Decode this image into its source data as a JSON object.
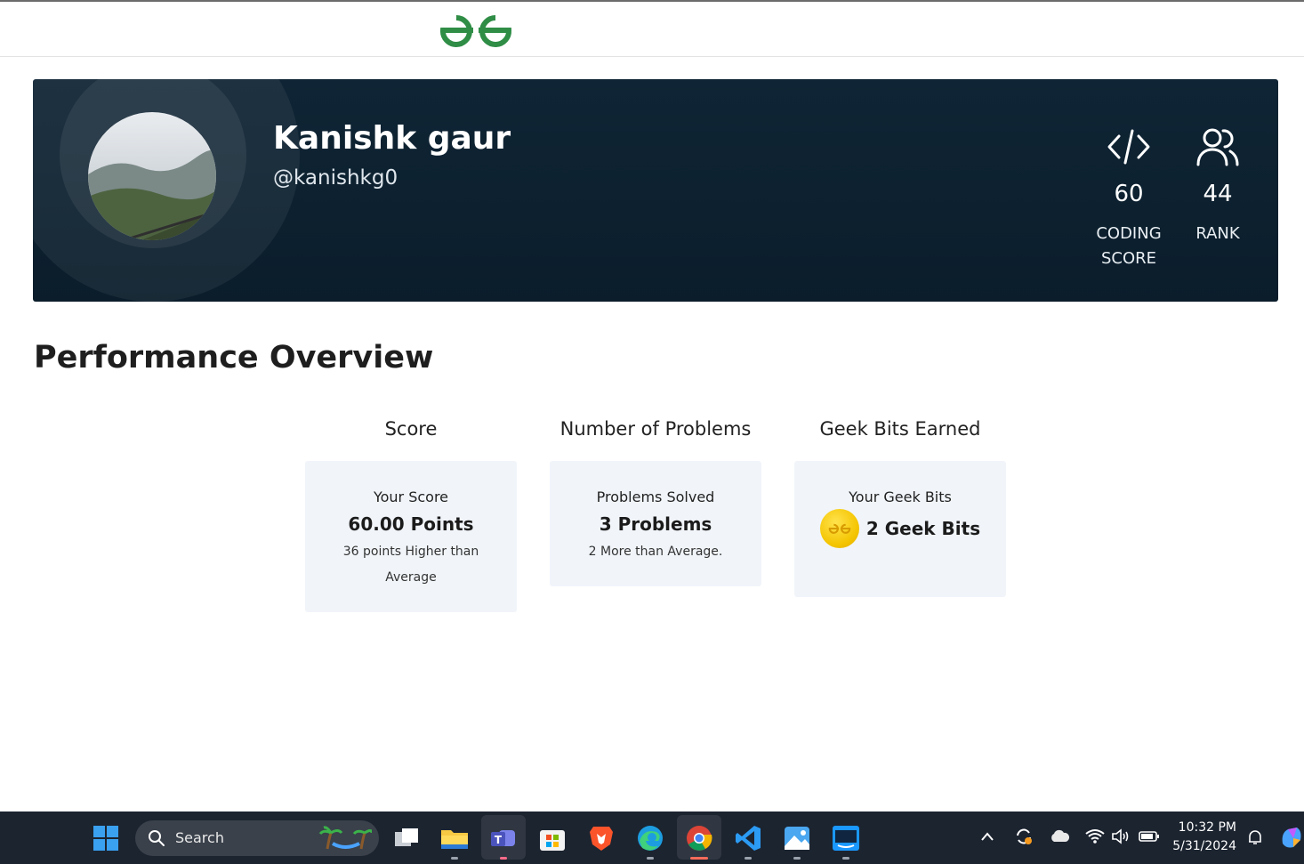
{
  "profile": {
    "name": "Kanishk gaur",
    "handle": "@kanishkg0",
    "stats": [
      {
        "value": "60",
        "label_line1": "CODING",
        "label_line2": "SCORE"
      },
      {
        "value": "44",
        "label_line1": "RANK",
        "label_line2": ""
      }
    ]
  },
  "performance": {
    "title": "Performance Overview",
    "columns": [
      {
        "heading": "Score",
        "label": "Your Score",
        "value": "60.00 Points",
        "sub": "36 points Higher than Average"
      },
      {
        "heading": "Number of Problems",
        "label": "Problems Solved",
        "value": "3 Problems",
        "sub": "2 More than Average."
      },
      {
        "heading": "Geek Bits Earned",
        "label": "Your Geek Bits",
        "value": "2 Geek Bits",
        "sub": ""
      }
    ]
  },
  "taskbar": {
    "search_label": "Search",
    "time": "10:32 PM",
    "date": "5/31/2024",
    "apps": [
      "windows-start",
      "task-view",
      "file-explorer",
      "teams",
      "microsoft-store",
      "brave",
      "edge",
      "chrome",
      "vscode",
      "photos",
      "prime-video"
    ]
  },
  "colors": {
    "brand_green": "#2f8d46",
    "banner_bg": "#0d2232",
    "card_bg": "#f1f5fa"
  }
}
